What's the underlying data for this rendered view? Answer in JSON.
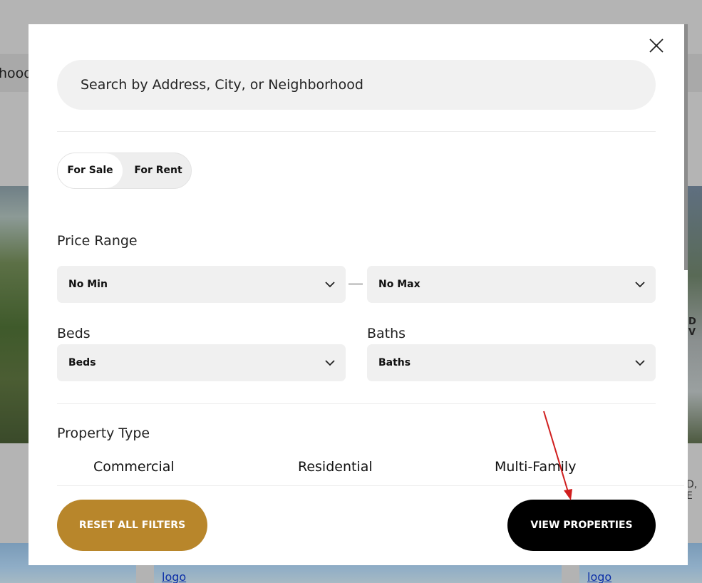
{
  "background": {
    "nav_text": "hood",
    "right_letters": "D V",
    "right_text": "D, E",
    "logo_1": "logo",
    "logo_2": "logo"
  },
  "search": {
    "placeholder": "Search by Address, City, or Neighborhood"
  },
  "listing_toggle": {
    "sale_label": "For Sale",
    "rent_label": "For Rent",
    "selected": "For Sale"
  },
  "price_range": {
    "label": "Price Range",
    "min_value": "No Min",
    "max_value": "No Max"
  },
  "beds": {
    "label": "Beds",
    "value": "Beds"
  },
  "baths": {
    "label": "Baths",
    "value": "Baths"
  },
  "property_type": {
    "label": "Property Type",
    "options": [
      "Commercial",
      "Residential",
      "Multi-Family"
    ]
  },
  "footer": {
    "reset_label": "RESET ALL FILTERS",
    "view_label": "VIEW PROPERTIES"
  },
  "colors": {
    "reset_button": "#b8862b",
    "view_button": "#000000",
    "annotation_arrow": "#d01e1e"
  },
  "icons": {
    "close": "close-icon",
    "dropdown": "chevron-down-icon"
  }
}
